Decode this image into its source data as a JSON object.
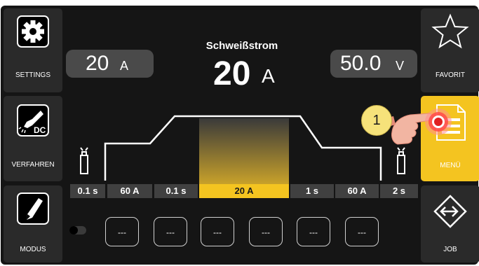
{
  "left_buttons": [
    {
      "label": "SETTINGS",
      "icon": "gear-icon"
    },
    {
      "label": "VERFAHREN",
      "icon": "torch-dc-icon",
      "badge": "DC"
    },
    {
      "label": "MODUS",
      "icon": "pen-icon"
    }
  ],
  "right_buttons": [
    {
      "label": "FAVORIT",
      "icon": "star-icon"
    },
    {
      "label": "MENÜ",
      "icon": "document-icon"
    },
    {
      "label": "JOB",
      "icon": "diamond-arrow-icon"
    }
  ],
  "readouts": {
    "left": {
      "value": "20",
      "unit": "A"
    },
    "right": {
      "value": "50.0",
      "unit": "V"
    }
  },
  "center": {
    "title": "Schweißstrom",
    "value": "20",
    "unit": "A"
  },
  "params": [
    "0.1 s",
    "60 A",
    "0.1 s",
    "20 A",
    "1 s",
    "60 A",
    "2 s"
  ],
  "active_param": 3,
  "slots": [
    "---",
    "---",
    "---",
    "---",
    "---",
    "---"
  ],
  "callout": "1",
  "colors": {
    "accent": "#f4c420",
    "background": "#151515",
    "button": "#2a2a2a"
  }
}
